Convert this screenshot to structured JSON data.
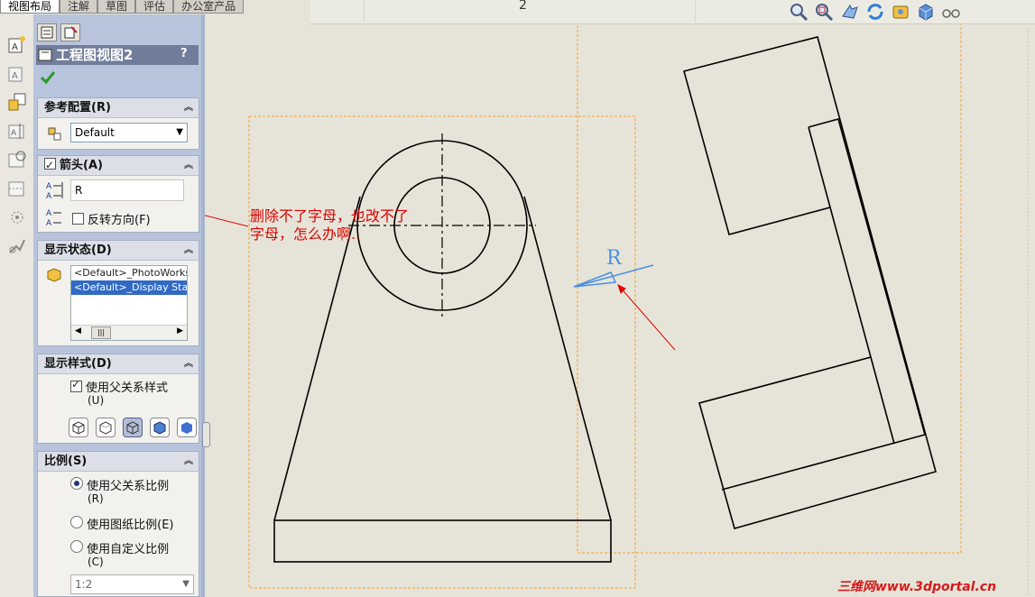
{
  "top_tabs": [
    "视图布局",
    "注解",
    "草图",
    "评估",
    "办公室产品"
  ],
  "sheet_number": "2",
  "toolbar_icons": [
    "zoom-fit-icon",
    "zoom-area-icon",
    "rotate-icon",
    "refresh-icon",
    "render-icon",
    "view-cube-icon",
    "glasses-icon"
  ],
  "left_strip_icons": [
    "model-view-icon",
    "projected-view-icon",
    "aux-view-icon",
    "section-view-icon",
    "detail-view-icon",
    "broken-view-icon",
    "crop-view-icon",
    "alternate-position-icon"
  ],
  "panel": {
    "title": "工程图视图2",
    "help": "?",
    "ok_icon": "checkmark-icon",
    "ref_config": {
      "header": "参考配置(R)",
      "value": "Default"
    },
    "arrow": {
      "header": "箭头(A)",
      "label_value": "R",
      "reverse_label": "反转方向(F)"
    },
    "display_state": {
      "header": "显示状态(D)",
      "items": [
        "<Default>_PhotoWorks",
        "<Default>_Display State"
      ]
    },
    "display_style": {
      "header": "显示样式(D)",
      "use_parent_label": "使用父关系样式",
      "use_parent_suffix": "(U)"
    },
    "scale": {
      "header": "比例(S)",
      "opt1": "使用父关系比例",
      "opt1_suffix": "(R)",
      "opt2": "使用图纸比例(E)",
      "opt3": "使用自定义比例",
      "opt3_suffix": "(C)",
      "custom_value": "1:2"
    }
  },
  "drawing": {
    "view_label": "R",
    "annotation_line1": "删除不了字母，也改不了",
    "annotation_line2": "字母，怎么办啊..",
    "colors": {
      "annotation": "#e00000",
      "arrow_label": "#4a90e2",
      "view_border": "#f5a030"
    }
  },
  "watermark": "三维网www.3dportal.cn"
}
